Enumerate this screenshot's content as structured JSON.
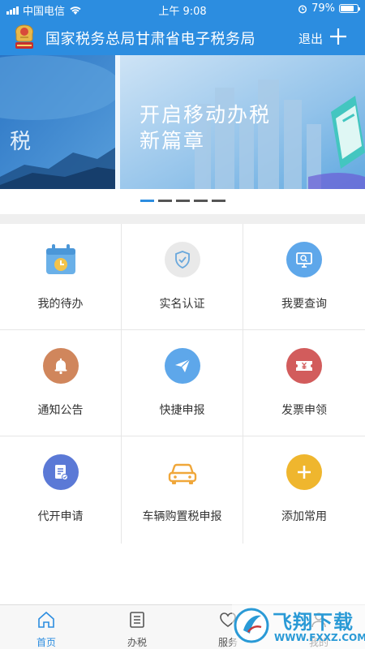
{
  "status_bar": {
    "carrier": "中国电信",
    "time": "上午 9:08",
    "battery": "79%",
    "battery_level": 0.79
  },
  "header": {
    "title": "国家税务总局甘肃省电子税务局",
    "logout_label": "退出",
    "icons": {
      "emblem": "national-tax-emblem",
      "add": "plus-icon"
    }
  },
  "banner": {
    "left_text": "税",
    "headline_line1": "开启移动办税",
    "headline_line2": "新篇章",
    "slide_count": 5,
    "active_slide": 1
  },
  "grid": {
    "items": [
      {
        "label": "我的待办",
        "icon": "calendar-clock-icon",
        "color": "#6ab0e8"
      },
      {
        "label": "实名认证",
        "icon": "shield-check-icon",
        "color": "#e9e9e9"
      },
      {
        "label": "我要查询",
        "icon": "monitor-search-icon",
        "color": "#5ea7ea"
      },
      {
        "label": "通知公告",
        "icon": "bell-icon",
        "color": "#d0865c"
      },
      {
        "label": "快捷申报",
        "icon": "paper-plane-icon",
        "color": "#5ea7ea"
      },
      {
        "label": "发票申领",
        "icon": "ticket-yen-icon",
        "color": "#d25c5c"
      },
      {
        "label": "代开申请",
        "icon": "document-edit-icon",
        "color": "#5b79d6"
      },
      {
        "label": "车辆购置税申报",
        "icon": "car-icon",
        "color": "#f0a73a"
      },
      {
        "label": "添加常用",
        "icon": "plus-circle-icon",
        "color": "#efb62e"
      }
    ]
  },
  "tabbar": {
    "tabs": [
      {
        "label": "首页",
        "icon": "home-icon",
        "active": true
      },
      {
        "label": "办税",
        "icon": "list-icon",
        "active": false
      },
      {
        "label": "服务",
        "icon": "heart-icon",
        "active": false
      },
      {
        "label": "我的",
        "icon": "user-icon",
        "active": false
      }
    ]
  },
  "watermark": {
    "text_cn": "飞翔下载",
    "url": "WWW.FXXZ.COM"
  },
  "colors": {
    "primary": "#2c8de0",
    "grid_border": "#e6e6e6",
    "band": "#efefef"
  }
}
